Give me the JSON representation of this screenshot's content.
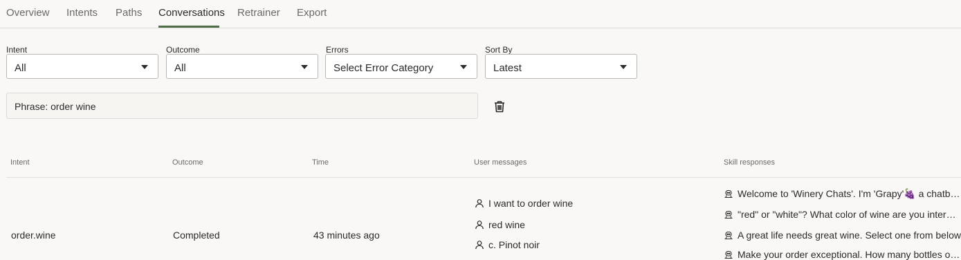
{
  "tabs": [
    {
      "label": "Overview"
    },
    {
      "label": "Intents"
    },
    {
      "label": "Paths"
    },
    {
      "label": "Conversations"
    },
    {
      "label": "Retrainer"
    },
    {
      "label": "Export"
    }
  ],
  "active_tab": "Conversations",
  "filters": {
    "intent": {
      "label": "Intent",
      "value": "All"
    },
    "outcome": {
      "label": "Outcome",
      "value": "All"
    },
    "errors": {
      "label": "Errors",
      "value": "Select Error Category"
    },
    "sort_by": {
      "label": "Sort By",
      "value": "Latest"
    }
  },
  "phrase_filter": "Phrase: order wine",
  "table": {
    "columns": [
      "Intent",
      "Outcome",
      "Time",
      "User messages",
      "Skill responses"
    ],
    "rows": [
      {
        "intent": "order.wine",
        "outcome": "Completed",
        "time": "43 minutes ago",
        "user_messages": [
          "I want to order wine",
          "red wine",
          "c. Pinot noir"
        ],
        "skill_responses": [
          "Welcome to 'Winery Chats'. I'm 'Grapy'🍇 a chatbot who can help you order wine",
          "\"red\" or \"white\"? What color of wine are you interested in?",
          "A great life needs great wine. Select one from below",
          "Make your order exceptional. How many bottles of wine?"
        ]
      }
    ]
  },
  "colors": {
    "accent": "#4f6d47",
    "background": "#f9f8f6",
    "border": "#b9b7b3"
  }
}
